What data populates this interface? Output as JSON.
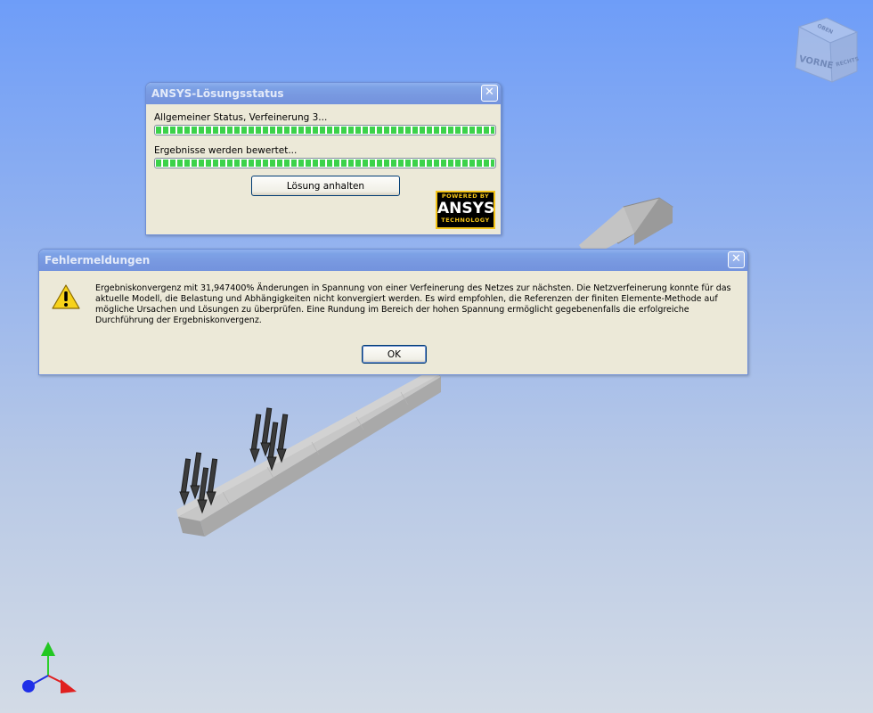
{
  "viewcube": {
    "front_label": "VORNE",
    "top_label": "OBEN",
    "right_label": "RECHTS"
  },
  "solve_dialog": {
    "title": "ANSYS-Lösungsstatus",
    "close_symbol": "✕",
    "overall_status": "Allgemeiner Status, Verfeinerung 3...",
    "overall_progress": 1.0,
    "results_status": "Ergebnisse werden bewertet...",
    "results_progress": 1.0,
    "stop_button": "Lösung anhalten",
    "logo": {
      "top": "POWERED BY",
      "brand": "ANSYS",
      "bottom": "TECHNOLOGY"
    }
  },
  "error_dialog": {
    "title": "Fehlermeldungen",
    "close_symbol": "✕",
    "message_lines": [
      "Ergebniskonvergenz mit 31,947400% Änderungen in Spannung von einer Verfeinerung des Netzes zur nächsten. Die Netzverfeinerung konnte für das",
      "aktuelle Modell, die Belastung und Abhängigkeiten nicht konvergiert werden. Es wird empfohlen, die Referenzen der finiten Elemente-Methode auf",
      "mögliche Ursachen und Lösungen zu überprüfen. Eine Rundung im Bereich der hohen Spannung ermöglicht gegebenenfalls die erfolgreiche",
      "Durchführung der Ergebniskonvergenz."
    ],
    "ok_button": "OK"
  },
  "colors": {
    "xp_title_blue": "#0a55e2",
    "progress_green": "#3cd24a",
    "dialog_bg": "#ece9d8"
  }
}
